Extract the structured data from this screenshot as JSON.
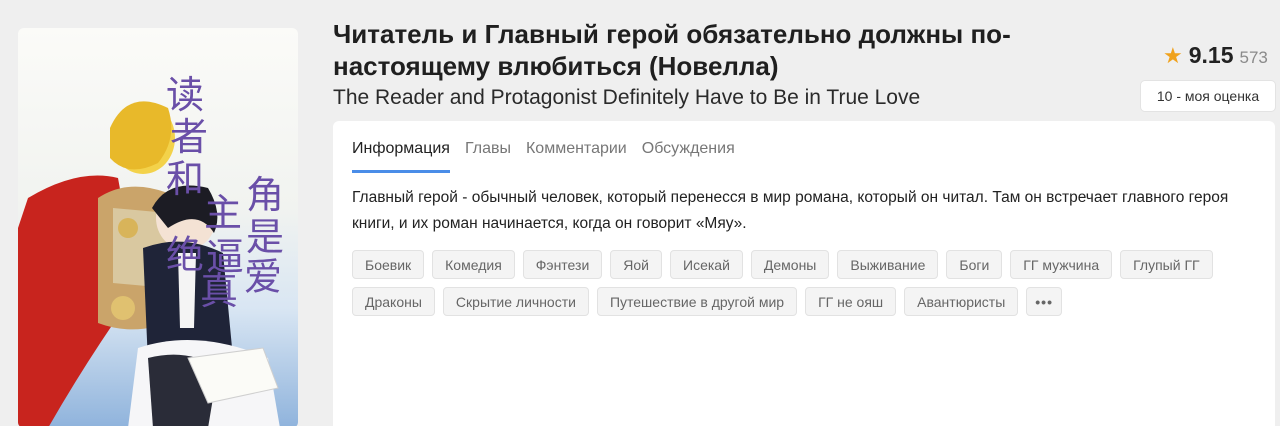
{
  "novel": {
    "title": "Читатель и Главный герой обязательно должны по-настоящему влюбиться (Новелла)",
    "title_line1": "Читатель и Главный герой обязательно должны по-",
    "title_line2": "настоящему влюбиться (Новелла)",
    "alt_title": "The Reader and Protagonist Definitely Have to Be in True Love",
    "cover_chars": [
      "读",
      "者",
      "和",
      "主",
      "角",
      "绝",
      "逼",
      "是",
      "真",
      "爱"
    ]
  },
  "rating": {
    "value": "9.15",
    "count": "573",
    "my_rating": "10 - моя оценка",
    "star_color": "#f0a21c"
  },
  "tabs": [
    {
      "label": "Информация",
      "active": true
    },
    {
      "label": "Главы",
      "active": false
    },
    {
      "label": "Комментарии",
      "active": false
    },
    {
      "label": "Обсуждения",
      "active": false
    }
  ],
  "description": "Главный герой - обычный человек, который перенесся в мир романа, который он читал. Там он встречает главного героя книги, и их роман начинается, когда он говорит «Мяу».",
  "tags": [
    "Боевик",
    "Комедия",
    "Фэнтези",
    "Яой",
    "Исекай",
    "Демоны",
    "Выживание",
    "Боги",
    "ГГ мужчина",
    "Глупый ГГ",
    "Драконы",
    "Скрытие личности",
    "Путешествие в другой мир",
    "ГГ не ояш",
    "Авантюристы"
  ],
  "more_tags_label": "•••",
  "colors": {
    "accent": "#4a8de8",
    "background": "#efefef"
  }
}
